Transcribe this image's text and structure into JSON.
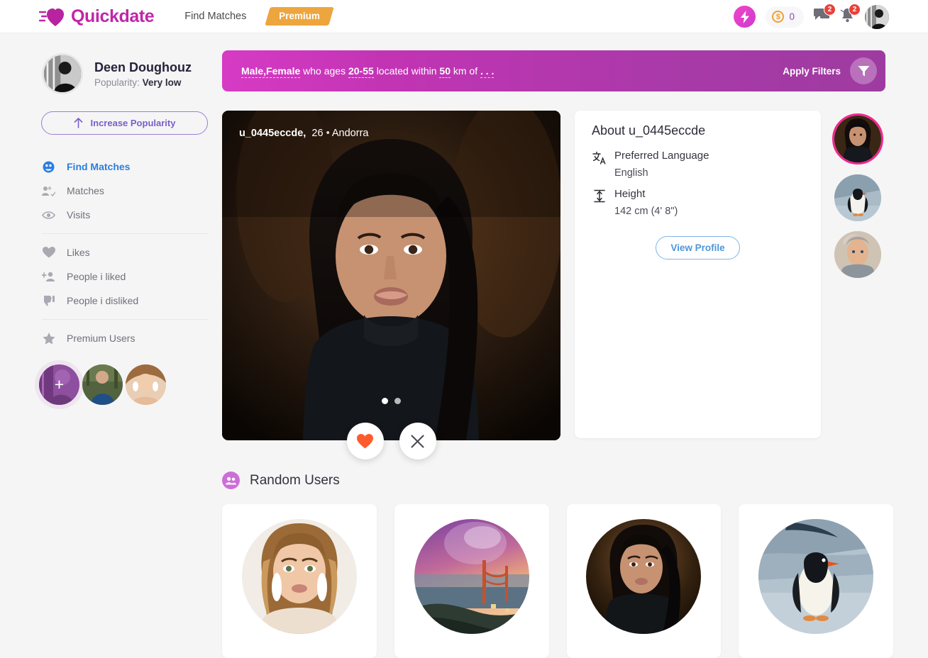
{
  "header": {
    "logo_text": "Quickdate",
    "logo_icon": "heart-icon",
    "nav_link": "Find Matches",
    "premium_label": "Premium",
    "bolt_icon": "lightning-bolt-icon",
    "coin_icon": "coin-dollar-icon",
    "coin_count": "0",
    "chat_icon": "chat-icon",
    "chat_badge": "2",
    "bell_icon": "bell-icon",
    "bell_badge": "2",
    "avatar_icon": "user-avatar"
  },
  "sidebar": {
    "profile": {
      "name": "Deen Doughouz",
      "popularity_label": "Popularity:",
      "popularity_value": "Very low"
    },
    "increase_button": "Increase Popularity",
    "increase_icon": "arrow-up-icon",
    "items": [
      {
        "label": "Find Matches",
        "icon": "globe-icon",
        "active": true
      },
      {
        "label": "Matches",
        "icon": "people-check-icon",
        "active": false
      },
      {
        "label": "Visits",
        "icon": "eye-icon",
        "active": false
      },
      {
        "label": "Likes",
        "icon": "heart-icon",
        "active": false
      },
      {
        "label": "People i liked",
        "icon": "person-add-icon",
        "active": false
      },
      {
        "label": "People i disliked",
        "icon": "thumbs-down-icon",
        "active": false
      },
      {
        "label": "Premium Users",
        "icon": "star-icon",
        "active": false
      }
    ],
    "stories": [
      {
        "name": "add-story",
        "plus": "+"
      },
      {
        "name": "story-man"
      },
      {
        "name": "story-woman"
      }
    ]
  },
  "filterbar": {
    "seg_gender": "Male,Female",
    "seg_who_ages": "who ages",
    "seg_ages": "20-55",
    "seg_located": "located within",
    "seg_distance": "50",
    "seg_km_of": "km of",
    "seg_ellipsis": ". . .",
    "apply_label": "Apply Filters",
    "filter_icon": "funnel-icon",
    "accent": "#c234b4"
  },
  "profile_card": {
    "username": "u_0445eccde,",
    "age": "26",
    "separator": "•",
    "location": "Andorra",
    "dots": [
      {
        "active": true
      },
      {
        "active": false
      }
    ],
    "like_icon": "heart-icon",
    "dislike_icon": "close-x-icon",
    "like_color": "#ff5a2b"
  },
  "about": {
    "title": "About u_0445eccde",
    "rows": [
      {
        "icon": "translate-icon",
        "label": "Preferred Language",
        "value": "English"
      },
      {
        "icon": "height-icon",
        "label": "Height",
        "value": "142 cm (4' 8\")"
      }
    ],
    "view_profile": "View Profile"
  },
  "thumbs": [
    {
      "name": "thumb-woman",
      "selected": true
    },
    {
      "name": "thumb-penguin",
      "selected": false
    },
    {
      "name": "thumb-man",
      "selected": false
    }
  ],
  "random_users": {
    "icon": "people-icon",
    "title": "Random Users",
    "cards": [
      {
        "name": "random-user-blonde"
      },
      {
        "name": "random-user-bridge"
      },
      {
        "name": "random-user-brunette"
      },
      {
        "name": "random-user-penguin"
      }
    ]
  }
}
